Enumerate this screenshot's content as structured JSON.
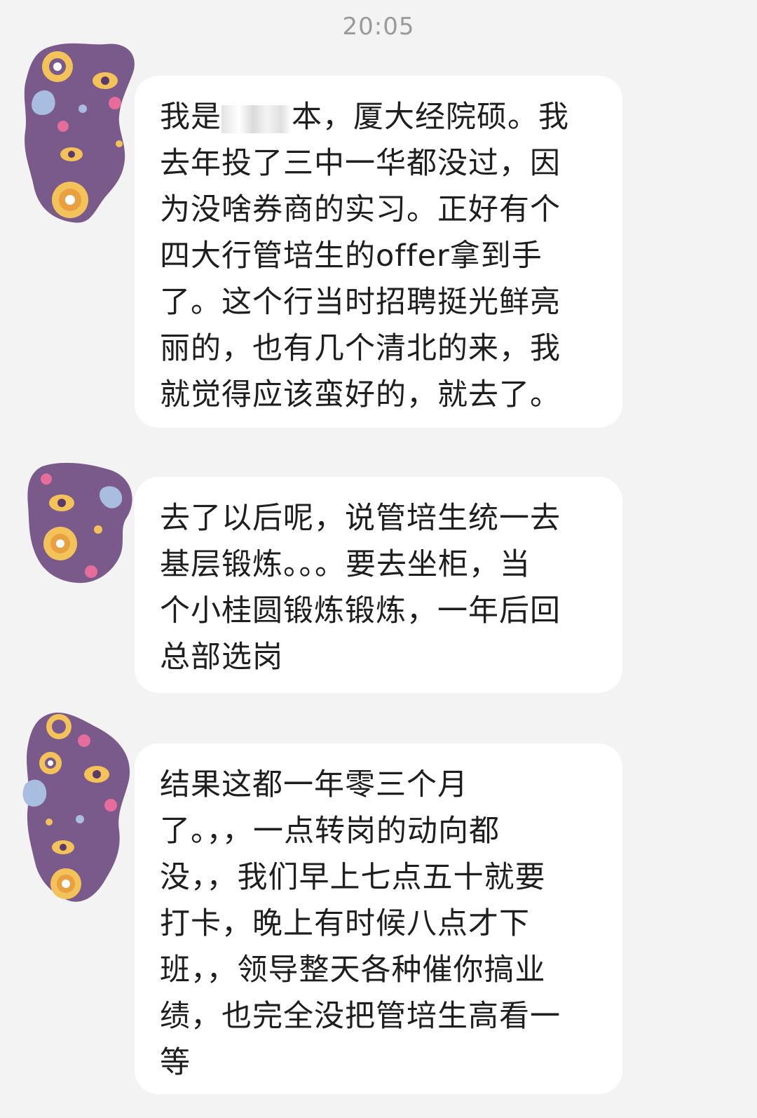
{
  "timestamp": "20:05",
  "colors": {
    "background": "#f3f3f3",
    "bubble": "#ffffff",
    "avatar": "#7a5a8a",
    "timestamp": "#9a9a9a"
  },
  "messages": [
    {
      "avatar_icon": "owl-pattern-avatar-icon",
      "lines": [
        [
          "我是",
          "本，厦大经院硕。我"
        ],
        "去年投了三中一华都没过，因",
        "为没啥券商的实习。正好有个",
        "四大行管培生的offer拿到手",
        "了。这个行当时招聘挺光鲜亮",
        "丽的，也有几个清北的来，我",
        "就觉得应该蛮好的，就去了。"
      ]
    },
    {
      "avatar_icon": "owl-pattern-avatar-icon",
      "lines": [
        "去了以后呢，说管培生统一去",
        "基层锻炼。。。要去坐柜，当",
        "个小桂圆锻炼锻炼，一年后回",
        "总部选岗"
      ]
    },
    {
      "avatar_icon": "owl-pattern-avatar-icon",
      "lines": [
        "结果这都一年零三个月",
        "了。，，一点转岗的动向都",
        "没，，我们早上七点五十就要",
        "打卡，晚上有时候八点才下",
        "班，，领导整天各种催你搞业",
        "绩，也完全没把管培生高看一",
        "等"
      ]
    }
  ]
}
